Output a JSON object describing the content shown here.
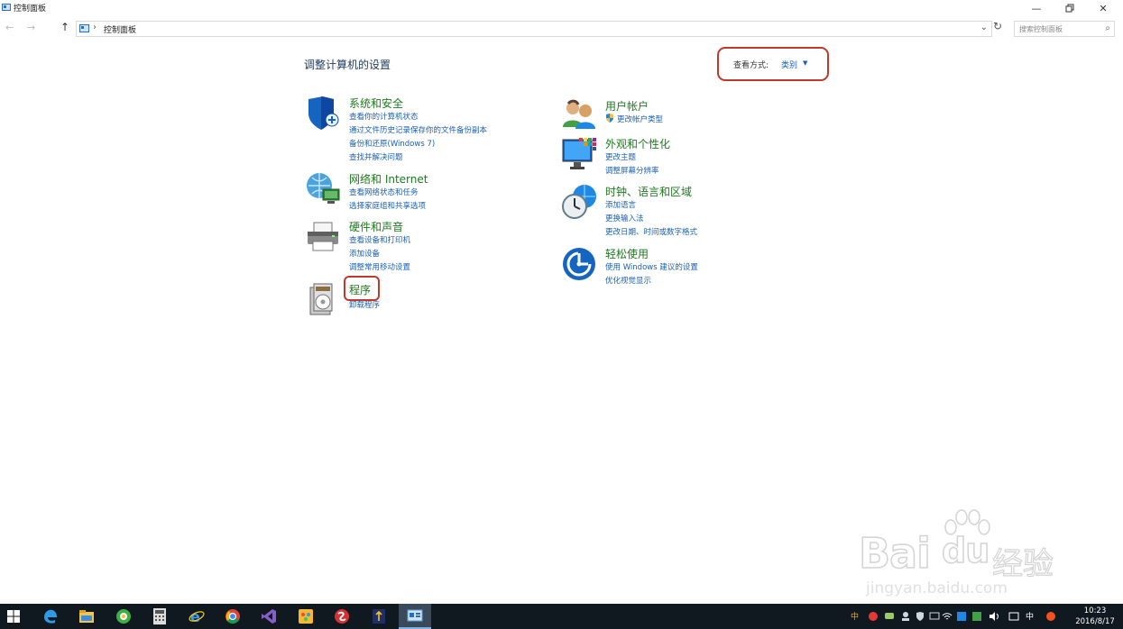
{
  "window": {
    "title": "控制面板",
    "minimize_icon": "minimize-icon",
    "maximize_icon": "restore-icon",
    "close_icon": "close-icon"
  },
  "address_bar": {
    "crumb": "控制面板",
    "search_placeholder": "搜索控制面板"
  },
  "main": {
    "heading": "调整计算机的设置",
    "view_by": {
      "label": "查看方式:",
      "value": "类别"
    }
  },
  "categories_left": [
    {
      "title": "系统和安全",
      "icon": "shield-icon",
      "links": [
        "查看你的计算机状态",
        "通过文件历史记录保存你的文件备份副本",
        "备份和还原(Windows 7)",
        "查找并解决问题"
      ]
    },
    {
      "title": "网络和 Internet",
      "icon": "network-globe-icon",
      "links": [
        "查看网络状态和任务",
        "选择家庭组和共享选项"
      ]
    },
    {
      "title": "硬件和声音",
      "icon": "printer-icon",
      "links": [
        "查看设备和打印机",
        "添加设备",
        "调整常用移动设置"
      ]
    },
    {
      "title": "程序",
      "icon": "programs-icon",
      "links": [
        "卸载程序"
      ]
    }
  ],
  "categories_right": [
    {
      "title": "用户帐户",
      "icon": "users-icon",
      "links": [
        "更改帐户类型"
      ]
    },
    {
      "title": "外观和个性化",
      "icon": "monitor-palette-icon",
      "links": [
        "更改主题",
        "调整屏幕分辨率"
      ]
    },
    {
      "title": "时钟、语言和区域",
      "icon": "clock-globe-icon",
      "links": [
        "添加语言",
        "更换输入法",
        "更改日期、时间或数字格式"
      ]
    },
    {
      "title": "轻松使用",
      "icon": "ease-of-access-icon",
      "links": [
        "使用 Windows 建议的设置",
        "优化视觉显示"
      ]
    }
  ],
  "watermark": {
    "main": "Bai",
    "paw": "du",
    "cn": "经验",
    "sub": "jingyan.baidu.com"
  },
  "taskbar": {
    "apps": [
      "start-icon",
      "edge-icon",
      "file-explorer-icon",
      "360-browser-icon",
      "calculator-icon",
      "ie-icon",
      "chrome-icon",
      "visual-studio-icon",
      "paint-icon",
      "snagit-icon",
      "app-icon",
      "control-panel-icon"
    ],
    "tray_text_1": "中",
    "tray_text_2": "中",
    "time": "10:23",
    "date": "2016/8/17"
  },
  "colors": {
    "category_title": "#1c7a1c",
    "link": "#1a5fb4",
    "highlight": "#c0392b",
    "taskbar": "#101820"
  }
}
